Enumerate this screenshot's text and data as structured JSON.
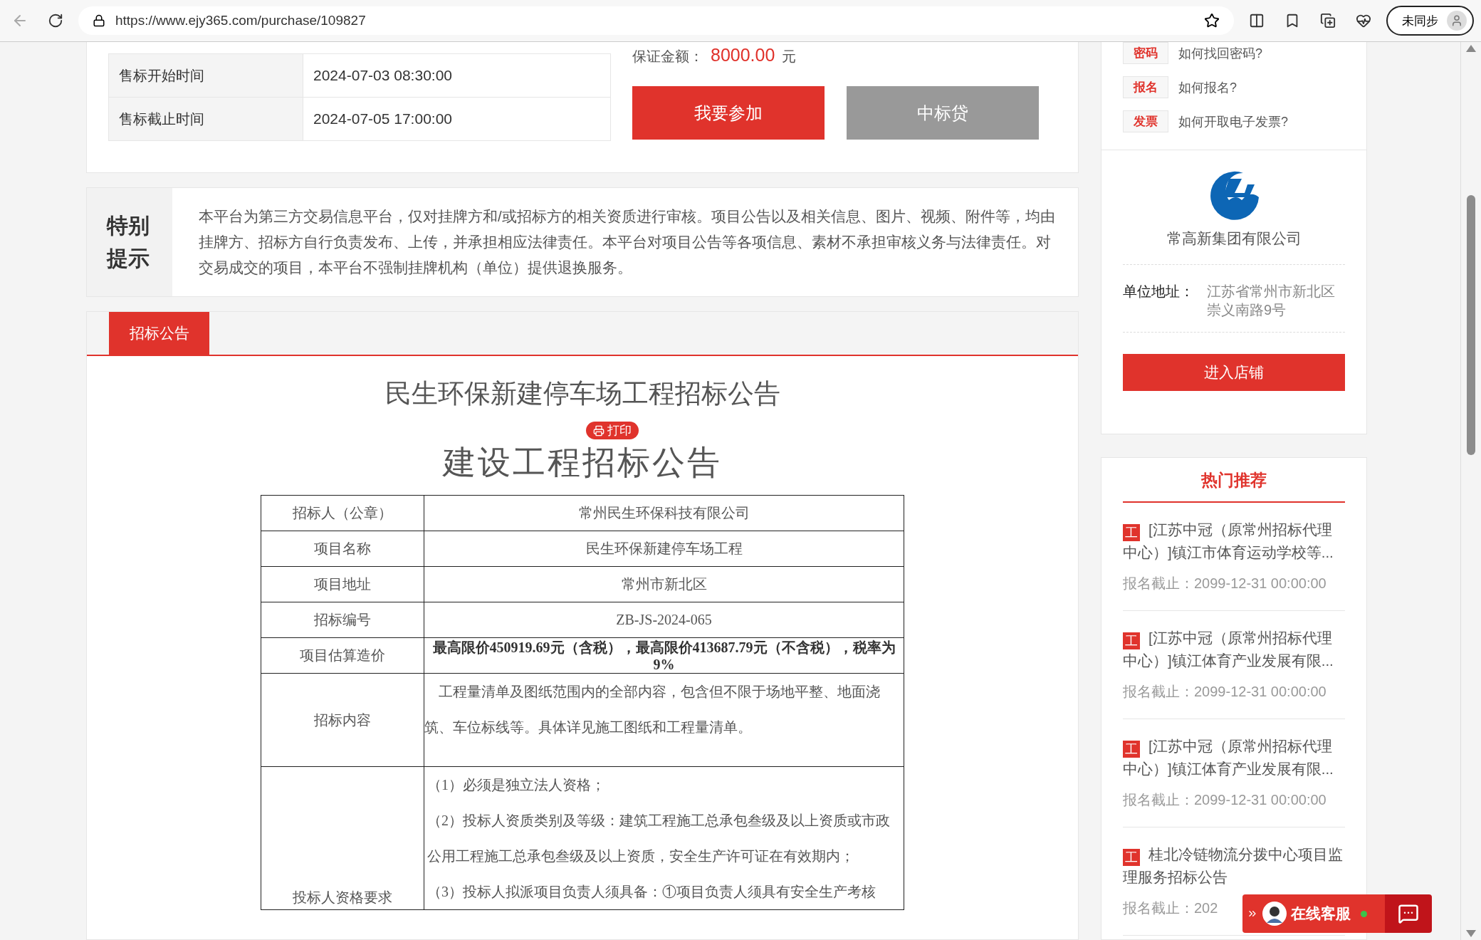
{
  "browser": {
    "url": "https://www.ejy365.com/purchase/109827",
    "profile_label": "未同步"
  },
  "sale_times": [
    {
      "label": "售标开始时间",
      "value": "2024-07-03 08:30:00"
    },
    {
      "label": "售标截止时间",
      "value": "2024-07-05 17:00:00"
    }
  ],
  "deposit": {
    "label": "保证金额：",
    "amount": "8000.00",
    "unit": "元"
  },
  "actions": [
    {
      "label": "我要参加",
      "kind": "primary"
    },
    {
      "label": "中标贷",
      "kind": "secondary"
    }
  ],
  "notice": {
    "title": "特别提示",
    "text": "本平台为第三方交易信息平台，仅对挂牌方和/或招标方的相关资质进行审核。项目公告以及相关信息、图片、视频、附件等，均由挂牌方、招标方自行负责发布、上传，并承担相应法律责任。本平台对项目公告等各项信息、素材不承担审核义务与法律责任。对交易成交的项目，本平台不强制挂牌机构（单位）提供退换服务。"
  },
  "tabs": [
    {
      "label": "招标公告",
      "selected": true
    }
  ],
  "announcement": {
    "title": "民生环保新建停车场工程招标公告",
    "print_label": "打印",
    "doc_title": "建设工程招标公告",
    "rows": [
      {
        "label": "招标人（公章）",
        "kind": "text",
        "value": "常州民生环保科技有限公司"
      },
      {
        "label": "项目名称",
        "kind": "text",
        "value": "民生环保新建停车场工程"
      },
      {
        "label": "项目地址",
        "kind": "text",
        "value": "常州市新北区"
      },
      {
        "label": "招标编号",
        "kind": "text",
        "value": "ZB-JS-2024-065"
      },
      {
        "label": "项目估算造价",
        "kind": "bold",
        "value": "最高限价450919.69元（含税），最高限价413687.79元（不含税），税率为9%"
      },
      {
        "label": "招标内容",
        "kind": "paragraph",
        "value": "工程量清单及图纸范围内的全部内容，包含但不限于场地平整、地面浇筑、车位标线等。具体详见施工图纸和工程量清单。"
      },
      {
        "label": "投标人资格要求",
        "kind": "list",
        "items": [
          "（1）必须是独立法人资格；",
          "（2）投标人资质类别及等级：建筑工程施工总承包叁级及以上资质或市政公用工程施工总承包叁级及以上资质，安全生产许可证在有效期内；",
          "（3）投标人拟派项目负责人须具备：①项目负责人须具有安全生产考核"
        ]
      }
    ]
  },
  "help_links": [
    {
      "tag": "密码",
      "text": "如何找回密码?"
    },
    {
      "tag": "报名",
      "text": "如何报名?"
    },
    {
      "tag": "发票",
      "text": "如何开取电子发票?"
    }
  ],
  "company": {
    "name": "常高新集团有限公司",
    "address_label": "单位地址：",
    "address": "江苏省常州市新北区崇义南路9号",
    "shop_button": "进入店铺"
  },
  "hot": {
    "title": "热门推荐",
    "items": [
      {
        "tag": "工",
        "title": "[江苏中冠（原常州招标代理中心）]镇江市体育运动学校等...",
        "deadline": "报名截止：2099-12-31 00:00:00"
      },
      {
        "tag": "工",
        "title": "[江苏中冠（原常州招标代理中心）]镇江体育产业发展有限...",
        "deadline": "报名截止：2099-12-31 00:00:00"
      },
      {
        "tag": "工",
        "title": "[江苏中冠（原常州招标代理中心）]镇江体育产业发展有限...",
        "deadline": "报名截止：2099-12-31 00:00:00"
      },
      {
        "tag": "工",
        "title": "桂北冷链物流分拨中心项目监理服务招标公告",
        "deadline": "报名截止：202"
      }
    ]
  },
  "chat": {
    "label": "在线客服",
    "online": true
  }
}
